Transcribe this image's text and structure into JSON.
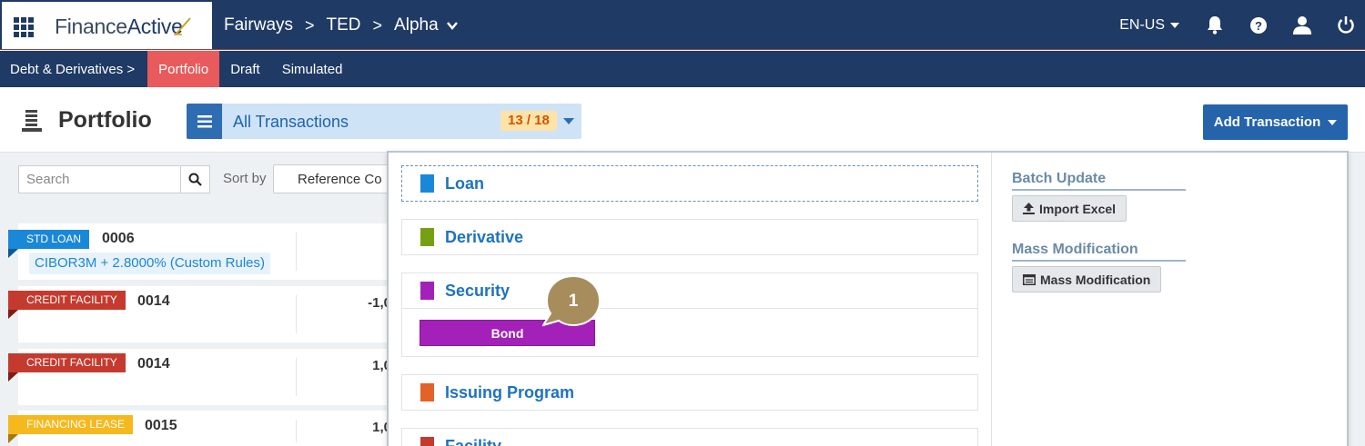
{
  "app": {
    "logo_part1": "Finance",
    "logo_part2": "Active"
  },
  "breadcrumbs": {
    "item1": "Fairways",
    "item2": "TED",
    "item3": "Alpha"
  },
  "header_right": {
    "language": "EN-US",
    "icons": [
      "bell-icon",
      "help-icon",
      "user-icon",
      "power-icon"
    ]
  },
  "subnav": {
    "section": "Debt & Derivatives",
    "tabs": [
      "Portfolio",
      "Draft",
      "Simulated"
    ],
    "active_tab": "Portfolio"
  },
  "page": {
    "title": "Portfolio",
    "selector_label": "All Transactions",
    "selector_count": "13 / 18",
    "add_button": "Add Transaction"
  },
  "toolbar": {
    "search_placeholder": "Search",
    "sort_label": "Sort by",
    "sort_value": "Reference Co"
  },
  "cards": [
    {
      "tag": "STD LOAN",
      "tag_color": "#1a88d8",
      "code": "0006",
      "amount": "",
      "rate": "CIBOR3M + 2.8000% (Custom Rules)"
    },
    {
      "tag": "CREDIT FACILITY",
      "tag_color": "#c53a2e",
      "code": "0014",
      "amount": "-1,0",
      "rate": ""
    },
    {
      "tag": "CREDIT FACILITY",
      "tag_color": "#c53a2e",
      "code": "0014",
      "amount": "1,0",
      "rate": ""
    },
    {
      "tag": "FINANCING LEASE",
      "tag_color": "#f5b91e",
      "code": "0015",
      "amount": "1,0",
      "rate": ""
    }
  ],
  "dropdown": {
    "categories": [
      {
        "name": "Loan",
        "color": "#1a88d8"
      },
      {
        "name": "Derivative",
        "color": "#76a013"
      },
      {
        "name": "Security",
        "color": "#a321b8",
        "sub_items": [
          "Bond"
        ]
      },
      {
        "name": "Issuing Program",
        "color": "#e2622a"
      },
      {
        "name": "Facility",
        "color": "#c53a2e"
      }
    ],
    "batch_update": {
      "title": "Batch Update",
      "button": "Import Excel"
    },
    "mass_modification": {
      "title": "Mass Modification",
      "button": "Mass Modification"
    }
  },
  "callout": {
    "number": "1"
  }
}
